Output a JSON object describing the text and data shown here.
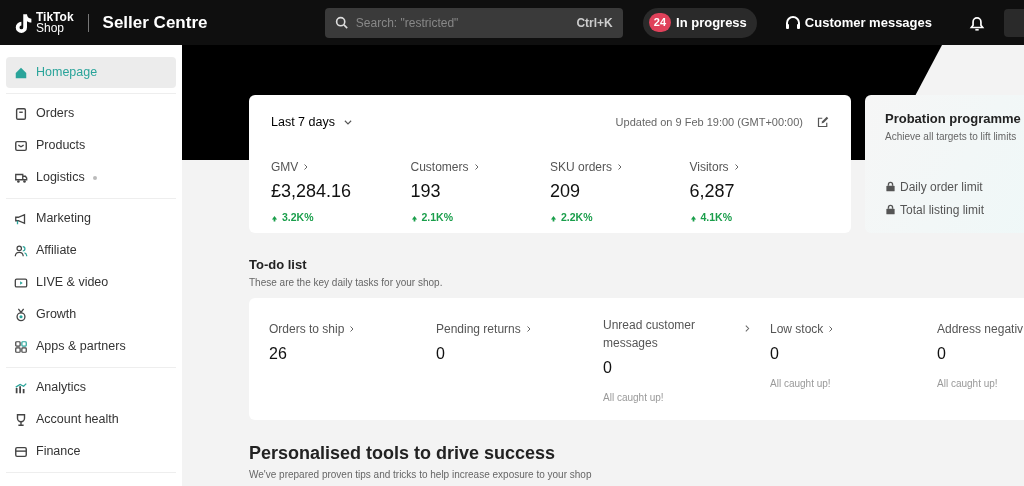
{
  "header": {
    "logo_line1": "TikTok",
    "logo_line2": "Shop",
    "app_title": "Seller Centre",
    "search": {
      "placeholder": "Search: \"restricted\"",
      "shortcut": "Ctrl+K"
    },
    "progress": {
      "count": "24",
      "label": "In progress"
    },
    "messages": "Customer messages"
  },
  "sidebar": {
    "groups": [
      [
        {
          "label": "Homepage",
          "selected": true
        }
      ],
      [
        {
          "label": "Orders",
          "selected": false
        },
        {
          "label": "Products",
          "selected": false
        },
        {
          "label": "Logistics",
          "selected": false,
          "dot": true
        }
      ],
      [
        {
          "label": "Marketing",
          "selected": false
        },
        {
          "label": "Affiliate",
          "selected": false
        },
        {
          "label": "LIVE & video",
          "selected": false
        },
        {
          "label": "Growth",
          "selected": false
        },
        {
          "label": "Apps & partners",
          "selected": false
        }
      ],
      [
        {
          "label": "Analytics",
          "selected": false
        },
        {
          "label": "Account health",
          "selected": false
        },
        {
          "label": "Finance",
          "selected": false
        }
      ]
    ]
  },
  "stats": {
    "period": "Last 7 days",
    "updated": "Updated on 9 Feb 19:00 (GMT+00:00)",
    "metrics": [
      {
        "label": "GMV",
        "value": "£3,284.16",
        "change": "3.2K%",
        "chevron": true
      },
      {
        "label": "Customers",
        "value": "193",
        "change": "2.1K%",
        "chevron": true
      },
      {
        "label": "SKU orders",
        "value": "209",
        "change": "2.2K%",
        "chevron": true
      },
      {
        "label": "Visitors",
        "value": "6,287",
        "change": "4.1K%",
        "chevron": true
      }
    ]
  },
  "probation": {
    "title": "Probation programme",
    "subtitle": "Achieve all targets to lift limits",
    "limits": [
      "Daily order limit",
      "Total listing limit"
    ]
  },
  "todo": {
    "title": "To-do list",
    "subtitle": "These are the key daily tasks for your shop.",
    "items": [
      {
        "label": "Orders to ship",
        "value": "26",
        "chevron": true
      },
      {
        "label": "Pending returns",
        "value": "0",
        "chevron": true
      },
      {
        "label": "Unread customer messages",
        "value": "0",
        "note": "All caught up!",
        "side_chevron": true,
        "chevron": false
      },
      {
        "label": "Low stock",
        "value": "0",
        "note": "All caught up!",
        "chevron": true
      },
      {
        "label": "Address negativ",
        "value": "0",
        "note": "All caught up!",
        "chevron": false
      }
    ]
  },
  "tools": {
    "title": "Personalised tools to drive success",
    "subtitle": "We've prepared proven tips and tricks to help increase exposure to your shop"
  }
}
